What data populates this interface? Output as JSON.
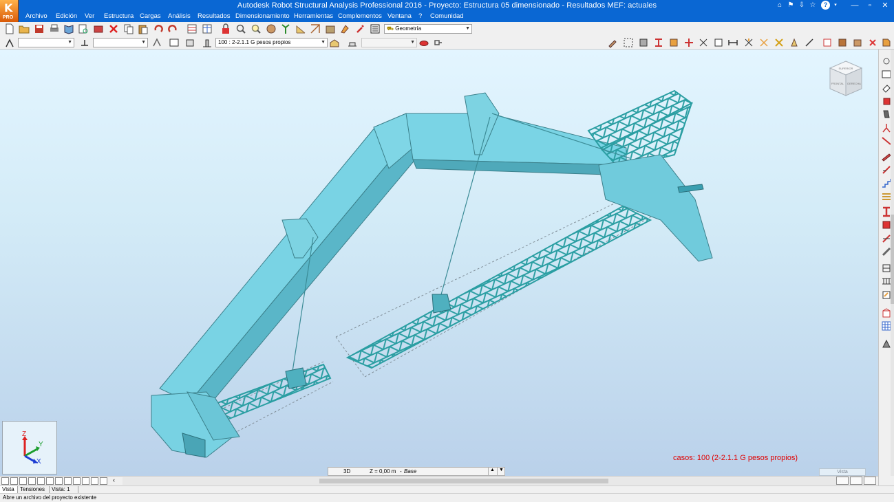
{
  "window": {
    "title": "Autodesk Robot Structural Analysis Professional 2016 - Proyecto: Estructura 05 dimensionado - Resultados MEF: actuales",
    "logo_label": "PRO"
  },
  "menu": [
    "Archivo",
    "Edición",
    "Ver",
    "Estructura",
    "Cargas",
    "Análisis",
    "Resultados",
    "Dimensionamiento",
    "Herramientas",
    "Complementos",
    "Ventana",
    "?",
    "Comunidad"
  ],
  "toolbar": {
    "layout_combo": "Geometría",
    "load_case_combo": "100 : 2-2.1.1 G pesos propios",
    "bar_combo": "",
    "node_combo": "",
    "extra_combo": ""
  },
  "viewport": {
    "case_label": "casos: 100 (2-2.1.1 G pesos propios)",
    "view_mode": "3D",
    "plane_value": "Z = 0,00 m",
    "plane_name": "Base",
    "vista_label": "Vista",
    "axes": {
      "z": "Z",
      "y": "Y",
      "x": "X"
    },
    "navcube": {
      "top": "SUPERIOR",
      "front": "FRONTAL",
      "right": "DERECHA"
    }
  },
  "tabs": [
    "Vista",
    "Tensiones",
    "Vista: 1"
  ],
  "status": {
    "message": "Abre un archivo del proyecto existente"
  },
  "colors": {
    "structure": "#78d4e4",
    "truss": "#2fa5a8",
    "titlebar": "#0a67d3",
    "case_label": "#e00000"
  }
}
